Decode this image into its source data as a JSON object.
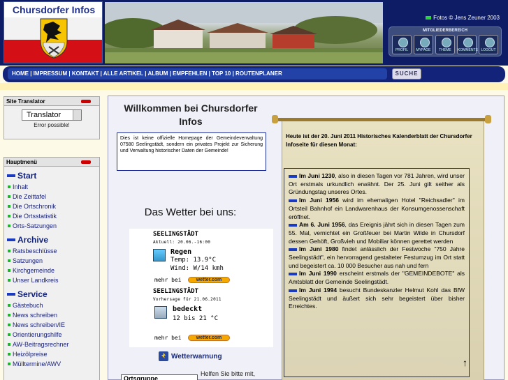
{
  "header": {
    "logo_title": "Chursdorfer Infos",
    "photo_credit": "Fotos © Jens Zeuner 2003",
    "member_area": {
      "title": "MITGLIEDERBEREICH",
      "icons": [
        {
          "label": "PROFIL",
          "icon": "profile-icon"
        },
        {
          "label": "MYPAGE",
          "icon": "mypage-icon"
        },
        {
          "label": "THEME",
          "icon": "theme-icon"
        },
        {
          "label": "KOMMENTS",
          "icon": "comments-icon"
        },
        {
          "label": "LOGOUT",
          "icon": "logout-icon"
        }
      ]
    }
  },
  "nav": {
    "items": [
      "HOME",
      "IMPRESSUM",
      "KONTAKT",
      "ALLE ARTIKEL",
      "ALBUM",
      "EMPFEHLEN",
      "TOP 10",
      "ROUTENPLANER"
    ],
    "separator": " | ",
    "search_label": "SUCHE"
  },
  "sidebar": {
    "translator_block": {
      "title": "Site Translator",
      "select_value": "Translator",
      "error": "Error possible!"
    },
    "menu_block": {
      "title": "Hauptmenü",
      "sections": [
        {
          "title": "Start",
          "items": [
            "Inhalt",
            "Die Zeittafel",
            "Die Ortschronik",
            "Die Ortsstatistik",
            "Orts-Satzungen"
          ]
        },
        {
          "title": "Archive",
          "items": [
            "Ratsbeschlüsse",
            "Satzungen",
            "Kirchgemeinde",
            "Unser Landkreis"
          ]
        },
        {
          "title": "Service",
          "items": [
            "Gästebuch",
            "News schreiben",
            "News schreiben/IE",
            "Orientierungshilfe",
            "AW-Beitragsrechner",
            "Heizölpreise",
            "Mülltermine/AWV"
          ]
        }
      ]
    }
  },
  "main": {
    "welcome": "Willkommen bei Chursdorfer Infos",
    "info_text": "Dies ist keine offizielle Homepage der Gemeindeverwaltung 07580 Seelingstädt, sondern ein privates Projekt zur Sicherung und Verwaltung historischer Daten der Gemeinde!",
    "weather_title": "Das Wetter bei uns:",
    "weather": {
      "today": {
        "city": "SEELINGSTÄDT",
        "sub": "Aktuell: 20.06.-16:00",
        "condition": "Regen",
        "temp": "Temp: 13.9°C",
        "wind": "Wind: W/14 kmh"
      },
      "tomorrow": {
        "city": "SEELINGSTÄDT",
        "sub": "Vorhersage für 21.06.2011",
        "condition": "bedeckt",
        "range": "12 bis 21 °C"
      },
      "mehr_label": "mehr bei",
      "brand": "wetter.com"
    },
    "warning_link": "Wetterwarnung",
    "bottom_left": "Ortsgruppe",
    "help_text": "Helfen Sie bitte mit,",
    "calendar": {
      "header": "Heute ist der 20. Juni 2011 Historisches Kalenderblatt der Chursdorfer Infoseite für diesen Monat:",
      "entries": [
        {
          "date": "Im Juni 1230",
          "text": ", also in diesen Tagen vor 781 Jahren, wird unser Ort erstmals urkundlich erwähnt. Der 25. Juni gilt seither als Gründungstag unseres Ortes."
        },
        {
          "date": "Im Juni 1956",
          "text": " wird im ehemaligen Hotel \"Reichsadler\" im Ortsteil Bahnhof ein Landwarenhaus der Konsumgenossenschaft eröffnet."
        },
        {
          "date": "Am 6. Juni 1956",
          "text": ", das Ereignis jährt sich in diesen Tagen zum 55. Mal, vernichtet ein Großfeuer bei Martin Wilde in Chursdorf dessen Gehöft, Großvieh und Mobiliar können gerettet werden"
        },
        {
          "date": "Im Juni 1980",
          "text": " findet anlässlich der Festwoche \"750 Jahre Seelingstädt\", ein hervorragend gestalteter Festumzug im Ort statt und begeistert ca. 10 000 Besucher aus nah und fern"
        },
        {
          "date": "Im Juni 1990",
          "text": " erscheint erstmals der \"GEMEINDEBOTE\" als Amtsblatt der Gemeinde Seelingstädt."
        },
        {
          "date": "Im Juni 1994",
          "text": " besucht Bundeskanzler Helmut Kohl das BfW Seelingstädt und äußert sich sehr begeistert über bisher Erreichtes."
        }
      ]
    }
  }
}
